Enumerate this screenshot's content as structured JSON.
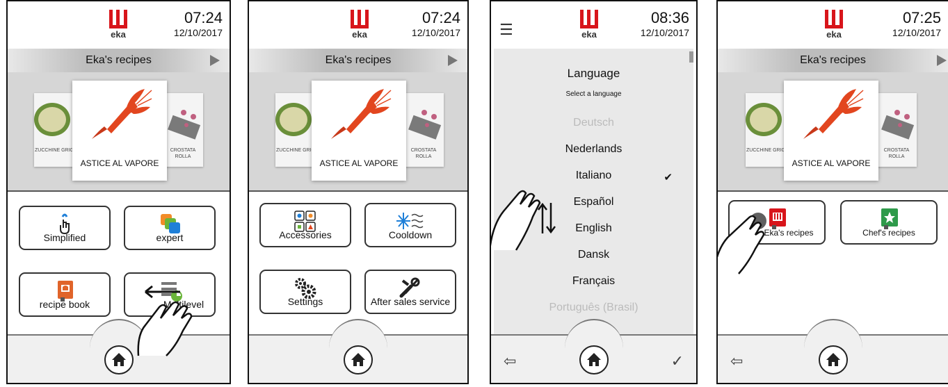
{
  "screens": [
    {
      "time": "07:24",
      "date": "12/10/2017",
      "title": "Eka's recipes",
      "carousel": {
        "left": "ZUCCHINE GRIG",
        "center": "ASTICE AL VAPORE",
        "right": "CROSTATA ROLLA"
      },
      "buttons": [
        "Simplified",
        "expert",
        "recipe book",
        "Multilevel"
      ]
    },
    {
      "time": "07:24",
      "date": "12/10/2017",
      "title": "Eka's recipes",
      "carousel": {
        "left": "ZUCCHINE GRIG",
        "center": "ASTICE AL VAPORE",
        "right": "CROSTATA ROLLA"
      },
      "buttons": [
        "Accessories",
        "Cooldown",
        "Settings",
        "After sales service"
      ]
    },
    {
      "time": "08:36",
      "date": "12/10/2017",
      "heading": "Language",
      "subheading": "Select a language",
      "languages": [
        "Deutsch",
        "Nederlands",
        "Italiano",
        "Español",
        "English",
        "Dansk",
        "Français",
        "Português (Brasil)"
      ],
      "selected": "Italiano"
    },
    {
      "time": "07:25",
      "date": "12/10/2017",
      "title": "Eka's recipes",
      "carousel": {
        "left": "ZUCCHINE GRIG",
        "center": "ASTICE AL VAPORE",
        "right": "CROSTATA ROLLA"
      },
      "buttons": [
        "Eka's recipes",
        "Chef's recipes"
      ]
    }
  ],
  "brand": "eka",
  "dots": "••",
  "colors": {
    "brand_red": "#d8151b",
    "lobster": "#e2461f",
    "green": "#6ab53a",
    "blue": "#1e7fd8",
    "orange": "#f28c28"
  }
}
